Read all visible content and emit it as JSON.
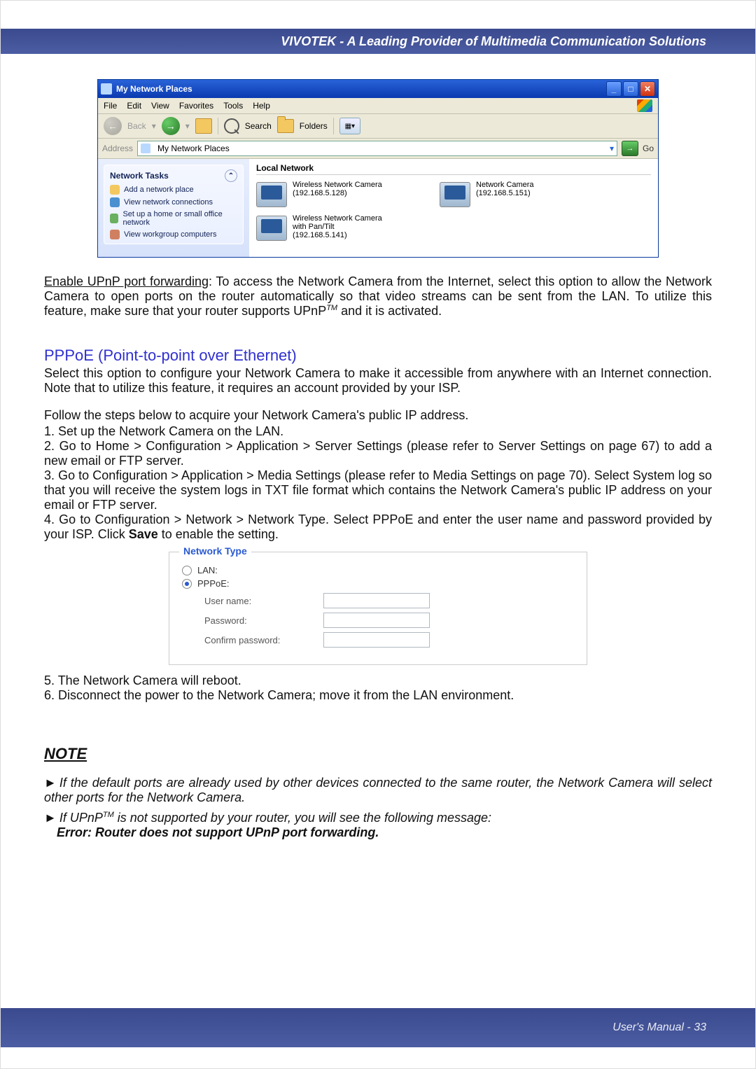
{
  "header": {
    "banner": "VIVOTEK - A Leading Provider of Multimedia Communication Solutions"
  },
  "xp": {
    "title": "My Network Places",
    "menu": [
      "File",
      "Edit",
      "View",
      "Favorites",
      "Tools",
      "Help"
    ],
    "toolbar": {
      "back": "Back",
      "search": "Search",
      "folders": "Folders"
    },
    "address": {
      "label": "Address",
      "value": "My Network Places",
      "go": "Go"
    },
    "tasks": {
      "title": "Network Tasks",
      "items": [
        "Add a network place",
        "View network connections",
        "Set up a home or small office network",
        "View workgroup computers"
      ]
    },
    "pane": {
      "title": "Local Network",
      "devices": [
        {
          "label": "Wireless Network Camera (192.168.5.128)"
        },
        {
          "label": "Network Camera (192.168.5.151)"
        },
        {
          "label": "Wireless Network Camera with Pan/Tilt (192.168.5.141)"
        }
      ]
    }
  },
  "para1": {
    "lead": "Enable UPnP port forwarding",
    "rest": ": To access the Network Camera from the Internet, select this option to allow the Network Camera to open ports on the router automatically so that video streams can be sent from the LAN. To utilize this feature, make sure that your router supports UPnP",
    "tail": " and it is activated."
  },
  "section": {
    "title": "PPPoE (Point-to-point over Ethernet)"
  },
  "para2": "Select this option to configure your Network Camera to make it accessible from anywhere with an Internet connection. Note that to utilize this feature, it requires an account provided by your ISP.",
  "para3": "Follow the steps below to acquire your Network Camera's public IP address.",
  "steps": [
    "1. Set up the Network Camera on the LAN.",
    "2. Go to Home > Configuration > Application > Server Settings (please refer to Server Settings on page 67) to add a new email or FTP server.",
    "3. Go to Configuration > Application > Media Settings (please refer to Media Settings on page 70). Select System log so that you will receive the system logs in TXT file format which contains the Network Camera's public IP address on your email or FTP server.",
    "4. Go to Configuration > Network > Network Type. Select PPPoE and enter the user name and password provided by your ISP. Click Save to enable the setting."
  ],
  "form": {
    "legend": "Network Type",
    "lan": "LAN:",
    "pppoe": "PPPoE:",
    "user": "User name:",
    "pass": "Password:",
    "confirm": "Confirm password:"
  },
  "steps2": [
    "5. The Network Camera will reboot.",
    "6. Disconnect the power to the Network Camera; move it from the LAN environment."
  ],
  "note": {
    "head": "NOTE",
    "items": [
      "If the default ports are already used by other devices connected to the same router, the Network Camera will select other ports for the Network Camera.",
      "If UPnP"
    ],
    "item2_mid": " is not supported by your router, you will see the following message:",
    "item2_err": "Error: Router does not support UPnP port forwarding."
  },
  "footer": {
    "text": "User's Manual - 33"
  }
}
